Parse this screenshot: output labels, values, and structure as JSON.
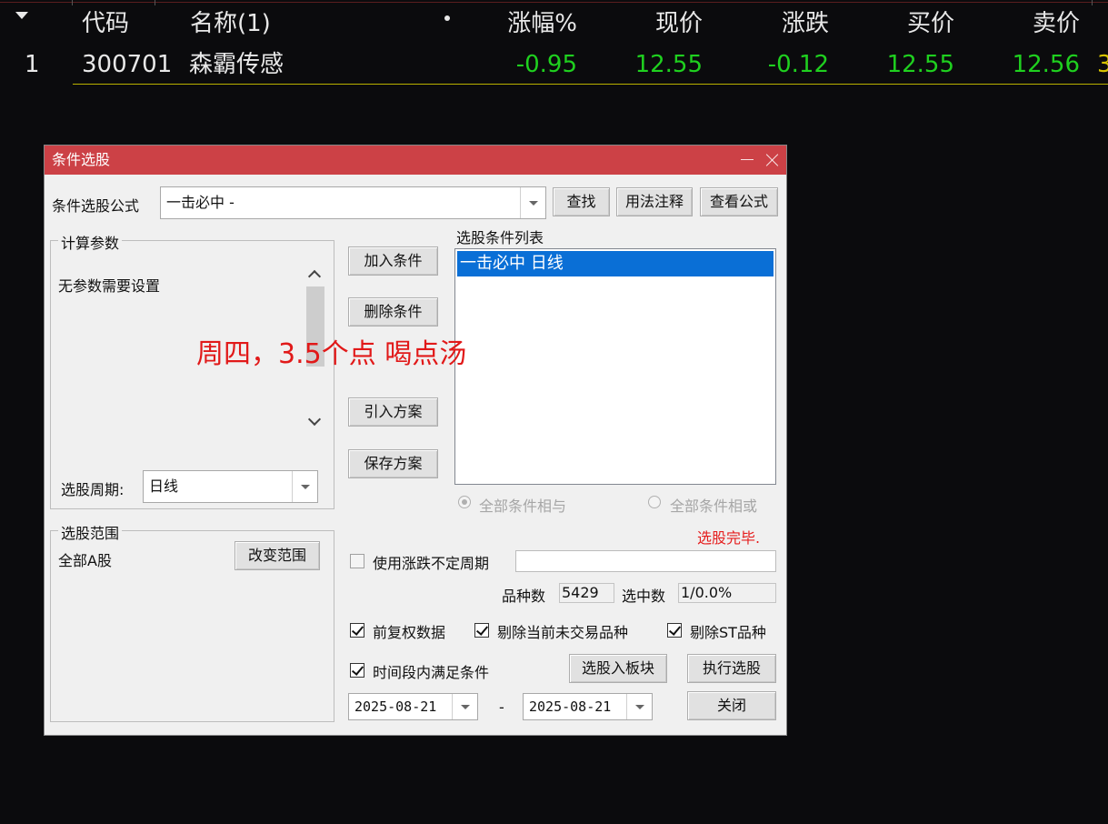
{
  "table": {
    "headers": {
      "code": "代码",
      "name": "名称(1)",
      "change_pct": "涨幅%",
      "price": "现价",
      "change": "涨跌",
      "bid": "买价",
      "ask": "卖价"
    },
    "rows": [
      {
        "index": "1",
        "code": "300701",
        "name": "森霸传感",
        "change_pct": "-0.95",
        "price": "12.55",
        "change": "-0.12",
        "bid": "12.55",
        "ask": "12.56",
        "overflow": "3"
      }
    ]
  },
  "dialog": {
    "title": "条件选股",
    "formula_label": "条件选股公式",
    "formula_value": "一击必中  -",
    "buttons": {
      "find": "查找",
      "usage_note": "用法注释",
      "view_formula": "查看公式",
      "add_condition": "加入条件",
      "delete_condition": "删除条件",
      "import_plan": "引入方案",
      "save_plan": "保存方案",
      "change_range": "改变范围",
      "to_block": "选股入板块",
      "execute": "执行选股",
      "close": "关闭"
    },
    "params_group": {
      "title": "计算参数",
      "text": "无参数需要设置"
    },
    "period_label": "选股周期:",
    "period_value": "日线",
    "range_group": {
      "title": "选股范围",
      "value": "全部A股"
    },
    "condition_list": {
      "title": "选股条件列表",
      "items": [
        "一击必中  日线"
      ]
    },
    "logic": {
      "and_label": "全部条件相与",
      "or_label": "全部条件相或",
      "selected": "and"
    },
    "status": "选股完毕.",
    "uncertain_period": {
      "label": "使用涨跌不定周期",
      "checked": false,
      "value": ""
    },
    "counts": {
      "total_label": "品种数",
      "total_value": "5429",
      "selected_label": "选中数",
      "selected_value": "1/0.0%"
    },
    "options": [
      {
        "label": "前复权数据",
        "checked": true
      },
      {
        "label": "剔除当前未交易品种",
        "checked": true
      },
      {
        "label": "剔除ST品种",
        "checked": true
      },
      {
        "label": "时间段内满足条件",
        "checked": true
      }
    ],
    "date_from": "2025-08-21",
    "date_separator": "-",
    "date_to": "2025-08-21"
  },
  "annotation": "周四，3.5个点 喝点汤",
  "colors": {
    "titlebar": "#cc4146",
    "up_down_green": "#1fd01f",
    "selection_blue": "#0a6fd6",
    "status_red": "#e51d1d"
  }
}
